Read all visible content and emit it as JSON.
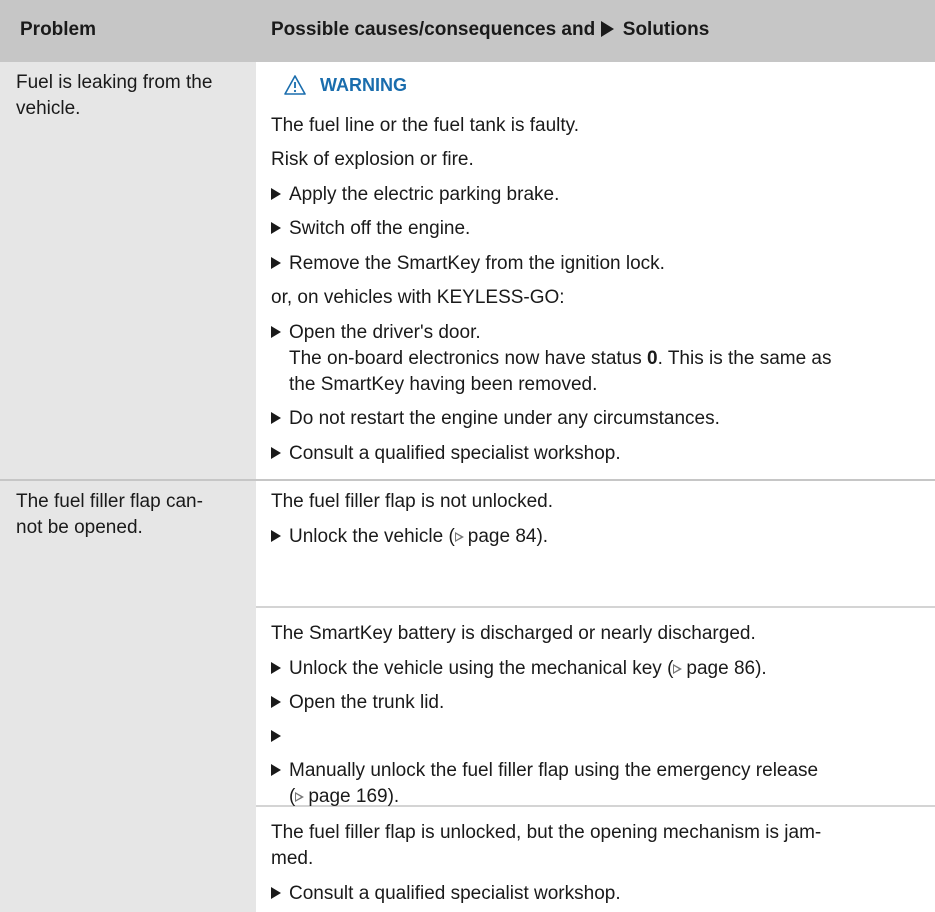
{
  "table": {
    "header": {
      "problem": "Problem",
      "causes_prefix": "Possible causes/consequences and",
      "causes_suffix": "Solutions"
    },
    "row1": {
      "problem_line1": "Fuel is leaking from the",
      "problem_line2": "vehicle.",
      "warning_label": "WARNING",
      "cause1": "The fuel line or the fuel tank is faulty.",
      "cause2": "Risk of explosion or fire.",
      "step1": "Apply the electric parking brake.",
      "step2": "Switch off the engine.",
      "step3": "Remove the SmartKey from the ignition lock.",
      "or_text": "or, on vehicles with KEYLESS-GO:",
      "step4": "Open the driver's door.",
      "note_a": "The on-board electronics now have status ",
      "note_status": "0",
      "note_b": ". This is the same as",
      "note_c": "the SmartKey having been removed.",
      "step5": "Do not restart the engine under any circumstances.",
      "step6": "Consult a qualified specialist workshop."
    },
    "row2": {
      "problem_line1": "The fuel filler flap can-",
      "problem_line2": "not be opened.",
      "block1": {
        "cause": "The fuel filler flap is not unlocked.",
        "step1_text": "Unlock the vehicle (",
        "step1_ref": "page 84",
        "step1_end": ")."
      },
      "block2": {
        "cause": "The SmartKey battery is discharged or nearly discharged.",
        "step1_text": "Unlock the vehicle using the mechanical key (",
        "step1_ref": "page 86",
        "step1_end": ").",
        "step2": "Open the trunk lid.",
        "step3": "",
        "step4_line1": "Manually unlock the fuel filler flap using the emergency release",
        "step4_ref_open": "(",
        "step4_ref": "page 169",
        "step4_end": ")."
      },
      "block3": {
        "cause_line1": "The fuel filler flap is unlocked, but the opening mechanism is jam-",
        "cause_line2": "med.",
        "step1": "Consult a qualified specialist workshop."
      }
    }
  }
}
